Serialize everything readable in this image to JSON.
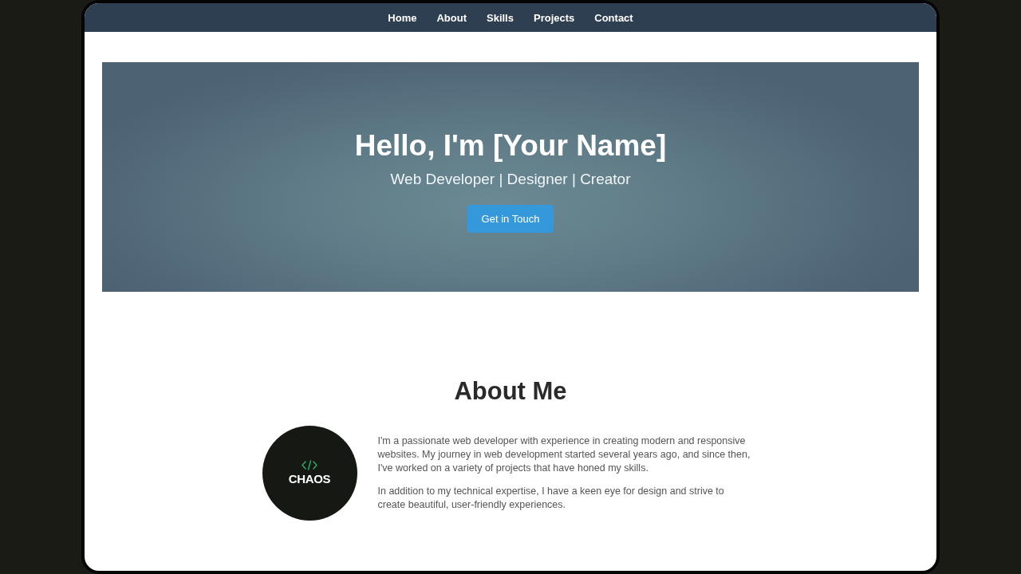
{
  "nav": {
    "items": [
      "Home",
      "About",
      "Skills",
      "Projects",
      "Contact"
    ]
  },
  "hero": {
    "title": "Hello, I'm [Your Name]",
    "subtitle": "Web Developer | Designer | Creator",
    "button": "Get in Touch"
  },
  "about": {
    "title": "About Me",
    "logo": {
      "text": "CHAOS"
    },
    "paragraphs": [
      "I'm a passionate web developer with experience in creating modern and responsive websites. My journey in web development started several years ago, and since then, I've worked on a variety of projects that have honed my skills.",
      "In addition to my technical expertise, I have a keen eye for design and strive to create beautiful, user-friendly experiences."
    ]
  }
}
